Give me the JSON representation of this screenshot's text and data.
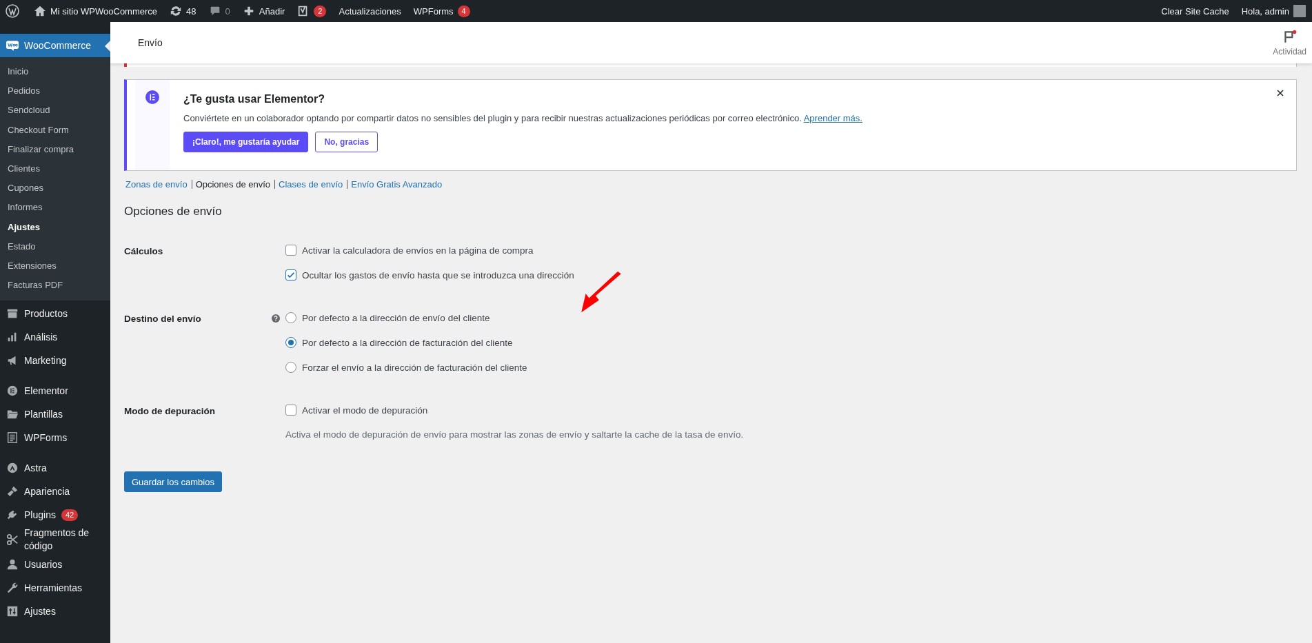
{
  "admin_bar": {
    "site": "Mi sitio WPWooCommerce",
    "updates": "48",
    "comments": "0",
    "new": "Añadir",
    "seo_badge": "2",
    "updates_link": "Actualizaciones",
    "forms": "WPForms",
    "forms_badge": "4",
    "cache": "Clear Site Cache",
    "greeting": "Hola, admin"
  },
  "sidebar": {
    "current": "WooCommerce",
    "submenu": [
      {
        "label": "Inicio",
        "selected": false
      },
      {
        "label": "Pedidos",
        "selected": false
      },
      {
        "label": "Sendcloud",
        "selected": false
      },
      {
        "label": "Checkout Form",
        "selected": false
      },
      {
        "label": "Finalizar compra",
        "selected": false
      },
      {
        "label": "Clientes",
        "selected": false
      },
      {
        "label": "Cupones",
        "selected": false
      },
      {
        "label": "Informes",
        "selected": false
      },
      {
        "label": "Ajustes",
        "selected": true
      },
      {
        "label": "Estado",
        "selected": false
      },
      {
        "label": "Extensiones",
        "selected": false
      },
      {
        "label": "Facturas PDF",
        "selected": false
      }
    ],
    "groups": [
      {
        "items": [
          {
            "label": "Productos",
            "kind": "archive"
          },
          {
            "label": "Análisis",
            "kind": "chart"
          },
          {
            "label": "Marketing",
            "kind": "megaphone"
          }
        ]
      },
      {
        "items": [
          {
            "label": "Elementor",
            "kind": "elementor"
          },
          {
            "label": "Plantillas",
            "kind": "folder"
          },
          {
            "label": "WPForms",
            "kind": "form"
          }
        ]
      },
      {
        "items": [
          {
            "label": "Astra",
            "kind": "astra"
          },
          {
            "label": "Apariencia",
            "kind": "brush"
          },
          {
            "label": "Plugins",
            "kind": "plug",
            "badge": "42"
          },
          {
            "label": "Fragmentos de código",
            "kind": "scissors"
          },
          {
            "label": "Usuarios",
            "kind": "user"
          },
          {
            "label": "Herramientas",
            "kind": "wrench"
          },
          {
            "label": "Ajustes",
            "kind": "sliders"
          }
        ]
      }
    ]
  },
  "header": {
    "title": "Envío",
    "activity": "Actividad"
  },
  "notice": {
    "title": "¿Te gusta usar Elementor?",
    "text": "Conviértete en un colaborador optando por compartir datos no sensibles del plugin y para recibir nuestras actualizaciones periódicas por correo electrónico.",
    "link": "Aprender más.",
    "primary": "¡Claro!, me gustaría ayudar",
    "secondary": "No, gracias"
  },
  "subnav": [
    {
      "label": "Zonas de envío",
      "selected": false
    },
    {
      "label": "Opciones de envío",
      "selected": true
    },
    {
      "label": "Clases de envío",
      "selected": false
    },
    {
      "label": "Envío Gratis Avanzado",
      "selected": false
    }
  ],
  "heading": "Opciones de envío",
  "sections": [
    {
      "label": "Cálculos",
      "kind": "checkbox",
      "help": false,
      "options": [
        {
          "label": "Activar la calculadora de envíos en la página de compra",
          "checked": false
        },
        {
          "label": "Ocultar los gastos de envío hasta que se introduzca una dirección",
          "checked": true
        }
      ]
    },
    {
      "label": "Destino del envío",
      "kind": "radio",
      "help": true,
      "options": [
        {
          "label": "Por defecto a la dirección de envío del cliente",
          "selected": false
        },
        {
          "label": "Por defecto a la dirección de facturación del cliente",
          "selected": true
        },
        {
          "label": "Forzar el envío a la dirección de facturación del cliente",
          "selected": false
        }
      ]
    },
    {
      "label": "Modo de depuración",
      "kind": "checkbox",
      "help": false,
      "options": [
        {
          "label": "Activar el modo de depuración",
          "checked": false
        }
      ],
      "description": "Activa el modo de depuración de envío para mostrar las zonas de envío y saltarte la cache de la tasa de envío."
    }
  ],
  "save": "Guardar los cambios"
}
